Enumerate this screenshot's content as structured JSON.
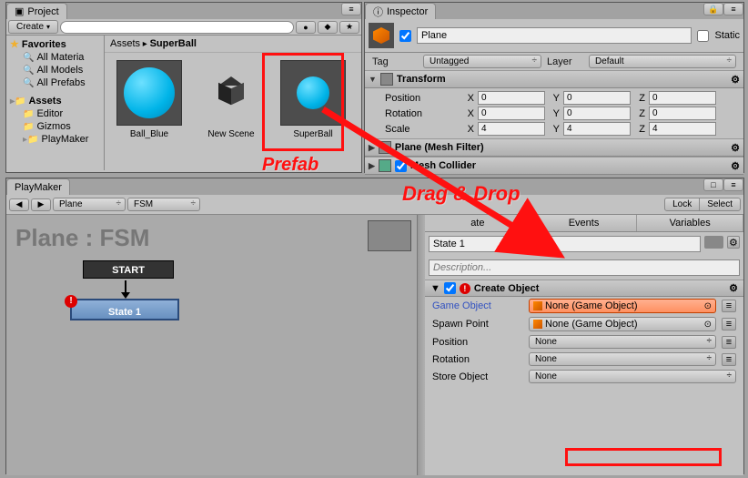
{
  "project": {
    "tab": "Project",
    "create_btn": "Create",
    "search_placeholder": "",
    "favorites_label": "Favorites",
    "fav_items": [
      "All Materia",
      "All Models",
      "All Prefabs"
    ],
    "assets_label": "Assets",
    "asset_folders": [
      "Editor",
      "Gizmos",
      "PlayMaker"
    ],
    "breadcrumb_root": "Assets",
    "breadcrumb_current": "SuperBall",
    "grid": [
      {
        "name": "Ball_Blue",
        "type": "sphere"
      },
      {
        "name": "New Scene",
        "type": "scene"
      },
      {
        "name": "SuperBall",
        "type": "prefab"
      }
    ]
  },
  "inspector": {
    "tab": "Inspector",
    "enabled": true,
    "name": "Plane",
    "static_label": "Static",
    "tag_label": "Tag",
    "tag_value": "Untagged",
    "layer_label": "Layer",
    "layer_value": "Default",
    "transform": {
      "title": "Transform",
      "rows": [
        {
          "label": "Position",
          "x": "0",
          "y": "0",
          "z": "0"
        },
        {
          "label": "Rotation",
          "x": "0",
          "y": "0",
          "z": "0"
        },
        {
          "label": "Scale",
          "x": "4",
          "y": "4",
          "z": "4"
        }
      ]
    },
    "components": [
      "Plane (Mesh Filter)",
      "Mesh Collider"
    ]
  },
  "playmaker": {
    "tab": "PlayMaker",
    "toolbar": {
      "obj": "Plane",
      "fsm": "FSM",
      "lock": "Lock",
      "select": "Select"
    },
    "canvas_title": "Plane : FSM",
    "start_label": "START",
    "state_label": "State 1",
    "side": {
      "tabs": [
        "ate",
        "Events",
        "Variables"
      ],
      "state_name": "State 1",
      "description_placeholder": "Description...",
      "action_title": "Create Object",
      "props": {
        "game_object": {
          "label": "Game Object",
          "value": "None (Game Object)"
        },
        "spawn_point": {
          "label": "Spawn Point",
          "value": "None (Game Object)"
        },
        "position": {
          "label": "Position",
          "value": "None"
        },
        "rotation": {
          "label": "Rotation",
          "value": "None"
        },
        "store": {
          "label": "Store Object",
          "value": "None"
        }
      }
    }
  },
  "annotations": {
    "prefab": "Prefab",
    "dragdrop": "Drag & Drop"
  }
}
